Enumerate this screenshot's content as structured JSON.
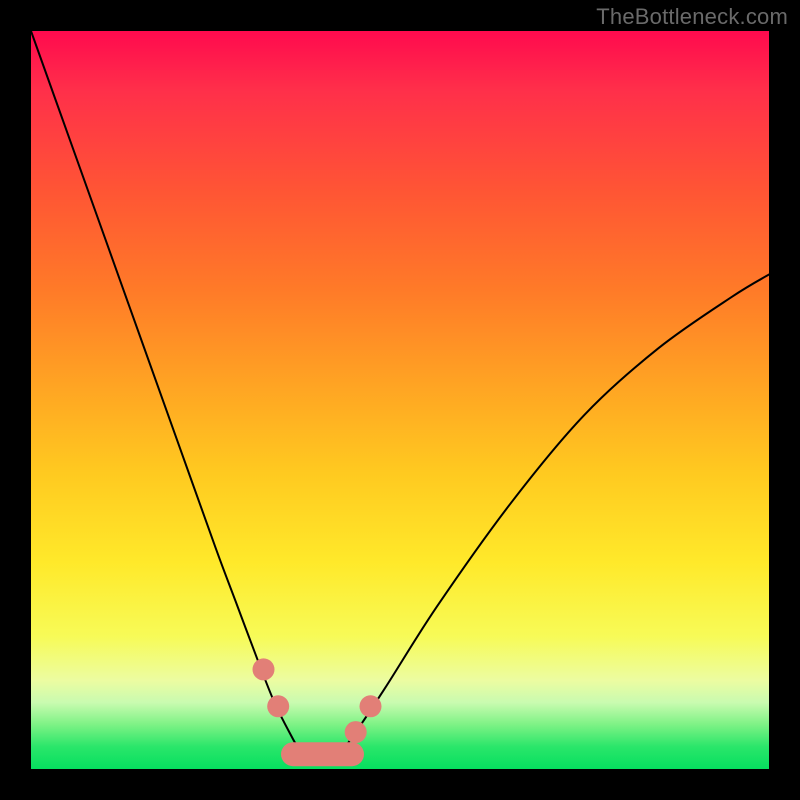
{
  "watermark": {
    "text": "TheBottleneck.com"
  },
  "chart_data": {
    "type": "line",
    "title": "",
    "xlabel": "",
    "ylabel": "",
    "xlim": [
      0,
      100
    ],
    "ylim": [
      0,
      100
    ],
    "grid": false,
    "legend": false,
    "background": "rainbow-vertical-gradient",
    "series": [
      {
        "name": "bottleneck-curve",
        "x": [
          0,
          5,
          10,
          15,
          20,
          25,
          28,
          31,
          33,
          35,
          36.5,
          38,
          40,
          42,
          44,
          48,
          55,
          65,
          75,
          85,
          95,
          100
        ],
        "y": [
          100,
          86,
          72,
          58,
          44,
          30,
          22,
          14,
          9,
          5,
          2.5,
          2,
          2,
          2.5,
          5,
          11,
          22,
          36,
          48,
          57,
          64,
          67
        ]
      }
    ],
    "markers": [
      {
        "name": "left-upper-dot",
        "x": 31.5,
        "y": 13.5
      },
      {
        "name": "left-lower-dot",
        "x": 33.5,
        "y": 8.5
      },
      {
        "name": "right-upper-dot",
        "x": 46.0,
        "y": 8.5
      },
      {
        "name": "right-lower-dot",
        "x": 44.0,
        "y": 5.0
      }
    ],
    "bottom_segment": {
      "x1": 35.5,
      "x2": 43.5,
      "y": 2.0
    }
  }
}
